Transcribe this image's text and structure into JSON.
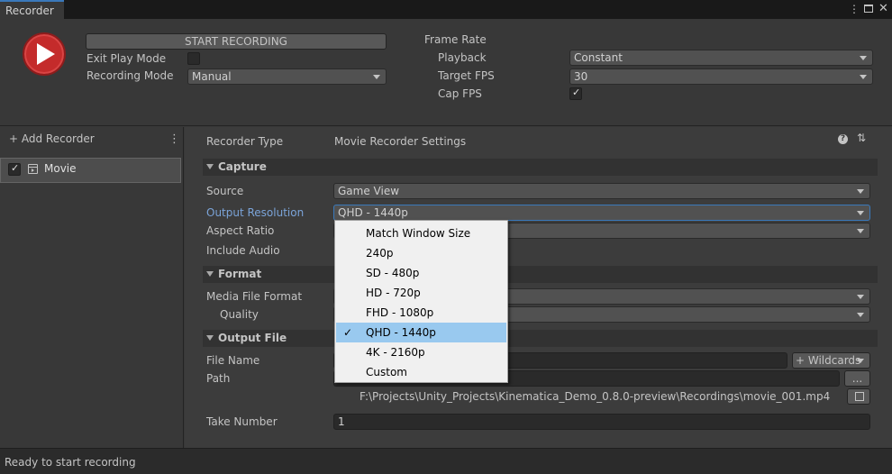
{
  "window": {
    "tab_title": "Recorder",
    "menu_icon": "kebab-menu-icon",
    "maximize_icon": "maximize-icon",
    "close_icon": "close-icon"
  },
  "top": {
    "start_label": "START RECORDING",
    "exit_play_mode_label": "Exit Play Mode",
    "exit_play_mode_checked": false,
    "recording_mode_label": "Recording Mode",
    "recording_mode_value": "Manual",
    "frame_rate_label": "Frame Rate",
    "playback_label": "Playback",
    "playback_value": "Constant",
    "target_fps_label": "Target FPS",
    "target_fps_value": "30",
    "cap_fps_label": "Cap FPS",
    "cap_fps_checked": true
  },
  "left": {
    "add_recorder_label": "+ Add Recorder",
    "items": [
      {
        "label": "Movie",
        "enabled": true
      }
    ]
  },
  "settings": {
    "recorder_type_label": "Recorder Type",
    "recorder_type_value": "Movie Recorder Settings",
    "capture": {
      "title": "Capture",
      "source_label": "Source",
      "source_value": "Game View",
      "output_resolution_label": "Output Resolution",
      "output_resolution_value": "QHD - 1440p",
      "aspect_ratio_label": "Aspect Ratio",
      "include_audio_label": "Include Audio"
    },
    "format": {
      "title": "Format",
      "media_file_format_label": "Media File Format",
      "quality_label": "Quality"
    },
    "output_file": {
      "title": "Output File",
      "file_name_label": "File Name",
      "wildcards_label": "+ Wildcards",
      "path_label": "Path",
      "browse_label": "...",
      "full_path": "F:\\Projects\\Unity_Projects\\Kinematica_Demo_0.8.0-preview\\Recordings\\movie_001.mp4",
      "take_number_label": "Take Number",
      "take_number_value": "1"
    }
  },
  "resolution_menu": {
    "options": [
      "Match Window Size",
      "240p",
      "SD - 480p",
      "HD - 720p",
      "FHD - 1080p",
      "QHD - 1440p",
      "4K - 2160p",
      "Custom"
    ],
    "selected_index": 5
  },
  "status": {
    "text": "Ready to start recording"
  },
  "colors": {
    "accent": "#3a79bb",
    "record_button": "#c42b2b",
    "highlight_label": "#7ba4d9",
    "menu_selection": "#99c9ef"
  }
}
